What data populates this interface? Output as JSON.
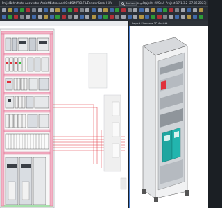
{
  "menu": {
    "items": [
      {
        "label": "Projekt"
      },
      {
        "label": "Schnittstellen"
      },
      {
        "label": "Auswertung"
      },
      {
        "label": "Ansicht"
      },
      {
        "label": "Extras"
      },
      {
        "label": "Add-Ons"
      },
      {
        "label": "PDM"
      },
      {
        "label": "PRO.FILE"
      },
      {
        "label": "Fenster"
      },
      {
        "label": "Konto"
      },
      {
        "label": "Hilfe"
      }
    ],
    "search_label": "Suchen (Strg+Q)",
    "app_title": "Projekt: (WSeU) Projekt 17.1.3.2 (27.06.2023)"
  },
  "panels": {
    "schematic_tab": "",
    "view3d_title": "Layout-Elemente 3D-Ansicht"
  },
  "colors": {
    "accent": "#4a7fd0",
    "wire_red": "#e0303a",
    "wire_green": "#2fbf3a",
    "component_gray": "#c9ced4",
    "component_teal": "#1fa6a0"
  }
}
